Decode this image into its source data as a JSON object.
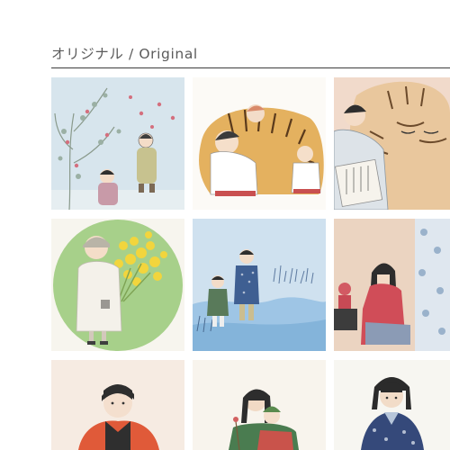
{
  "section": {
    "title": "オリジナル / Original"
  },
  "gallery": {
    "items": [
      {
        "subject": "children-under-flowering-tree",
        "bg": "#d6e4ec"
      },
      {
        "subject": "children-sleeping-on-tiger",
        "bg": "#fbfaf6"
      },
      {
        "subject": "child-asleep-on-tiger",
        "bg": "#f0d9c8"
      },
      {
        "subject": "girl-with-mimosa-bouquet",
        "bg": "#f6f4ec"
      },
      {
        "subject": "two-children-by-stream",
        "bg": "#cfe0ef"
      },
      {
        "subject": "girl-in-kimono-with-doll",
        "bg": "#ead3bf"
      },
      {
        "subject": "boy-in-red-coat",
        "bg": "#f5e9e0"
      },
      {
        "subject": "mother-carrying-child",
        "bg": "#f7f3ec"
      },
      {
        "subject": "girl-in-blue-kimono",
        "bg": "#f6f5f0"
      }
    ]
  }
}
